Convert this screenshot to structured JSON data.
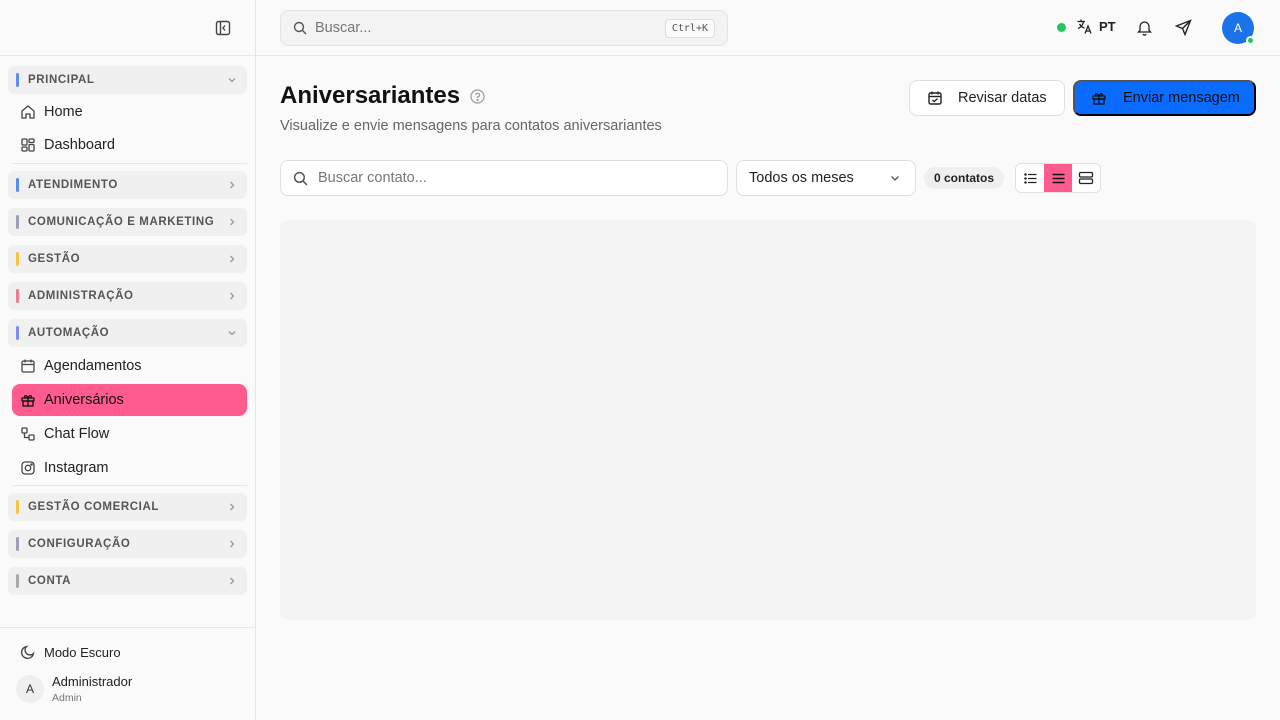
{
  "sidebar": {
    "sections": {
      "principal": {
        "label": "PRINCIPAL",
        "color": "#5b8def"
      },
      "atendimento": {
        "label": "ATENDIMENTO",
        "color": "#5b8def"
      },
      "comunicacao": {
        "label": "COMUNICAÇÃO E MARKETING",
        "color": "#9aa0b4"
      },
      "gestao": {
        "label": "GESTÃO",
        "color": "#f5c542"
      },
      "administracao": {
        "label": "ADMINISTRAÇÃO",
        "color": "#f07a8a"
      },
      "automacao": {
        "label": "AUTOMAÇÃO",
        "color": "#7b8cf0"
      },
      "gestao_comercial": {
        "label": "GESTÃO COMERCIAL",
        "color": "#f5c542"
      },
      "configuracao": {
        "label": "CONFIGURAÇÃO",
        "color": "#9aa0b4"
      },
      "conta": {
        "label": "CONTA",
        "color": "#aaaaaa"
      }
    },
    "items": {
      "home": "Home",
      "dashboard": "Dashboard",
      "agendamentos": "Agendamentos",
      "aniversarios": "Aniversários",
      "chat_flow": "Chat Flow",
      "instagram": "Instagram"
    },
    "dark_mode_label": "Modo Escuro",
    "user": {
      "initial": "A",
      "name": "Administrador",
      "role": "Admin"
    }
  },
  "header": {
    "search_placeholder": "Buscar...",
    "shortcut": "Ctrl+K",
    "language": "PT",
    "avatar_initial": "A"
  },
  "main": {
    "title": "Aniversariantes",
    "subtitle": "Visualize e envie mensagens para contatos aniversariantes",
    "review_button": "Revisar datas",
    "send_button": "Enviar mensagem",
    "contact_search_placeholder": "Buscar contato...",
    "month_filter": "Todos os meses",
    "contacts_count": "0 contatos"
  },
  "colors": {
    "accent_pink": "#ff5b8f",
    "primary_blue": "#0a6cff",
    "online_green": "#22c55e"
  }
}
